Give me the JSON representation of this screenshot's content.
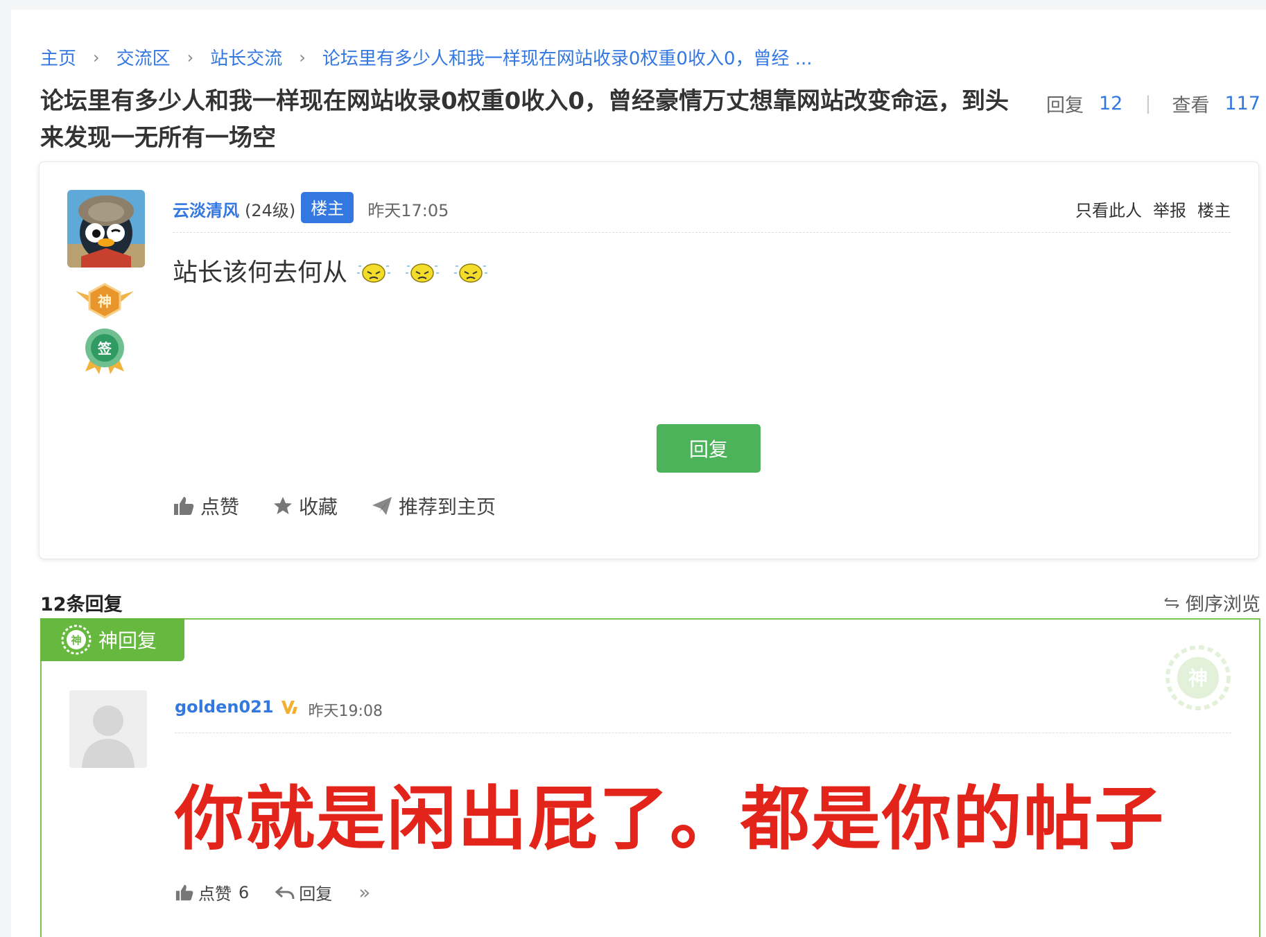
{
  "breadcrumb": {
    "items": [
      "主页",
      "交流区",
      "站长交流",
      "论坛里有多少人和我一样现在网站收录0权重0收入0，曾经 ..."
    ]
  },
  "thread": {
    "title": "论坛里有多少人和我一样现在网站收录0权重0收入0，曾经豪情万丈想靠网站改变命运，到头来发现一无所有一场空",
    "reply_label": "回复",
    "reply_count": "12",
    "view_label": "查看",
    "view_count": "117"
  },
  "post": {
    "author": "云淡清风",
    "level": "(24级)",
    "owner_tag": "楼主",
    "time": "昨天17:05",
    "actions": [
      "只看此人",
      "举报",
      "楼主"
    ],
    "content": "站长该何去何从",
    "emoji": "sweat-face-icon",
    "reply_button": "回复",
    "bottom_actions": {
      "like": "点赞",
      "favorite": "收藏",
      "recommend": "推荐到主页"
    },
    "badges": [
      "god-rank-badge-icon",
      "sign-in-badge-icon"
    ],
    "badge_text": {
      "god": "神",
      "sign": "签"
    }
  },
  "replies": {
    "header": "12条回复",
    "sort": "倒序浏览",
    "god_reply": {
      "ribbon": "神回复",
      "ribbon_icon_text": "神",
      "author": "golden021",
      "vip_icon": "vip-icon",
      "time": "昨天19:08",
      "content": "你就是闲出屁了。都是你的帖子",
      "like_label": "点赞",
      "like_count": "6",
      "reply_label": "回复",
      "more": "»"
    }
  },
  "colors": {
    "link": "#3377e0",
    "reply_button": "#4cb35a",
    "god_green": "#67b83f",
    "god_text_red": "#e3241b"
  }
}
